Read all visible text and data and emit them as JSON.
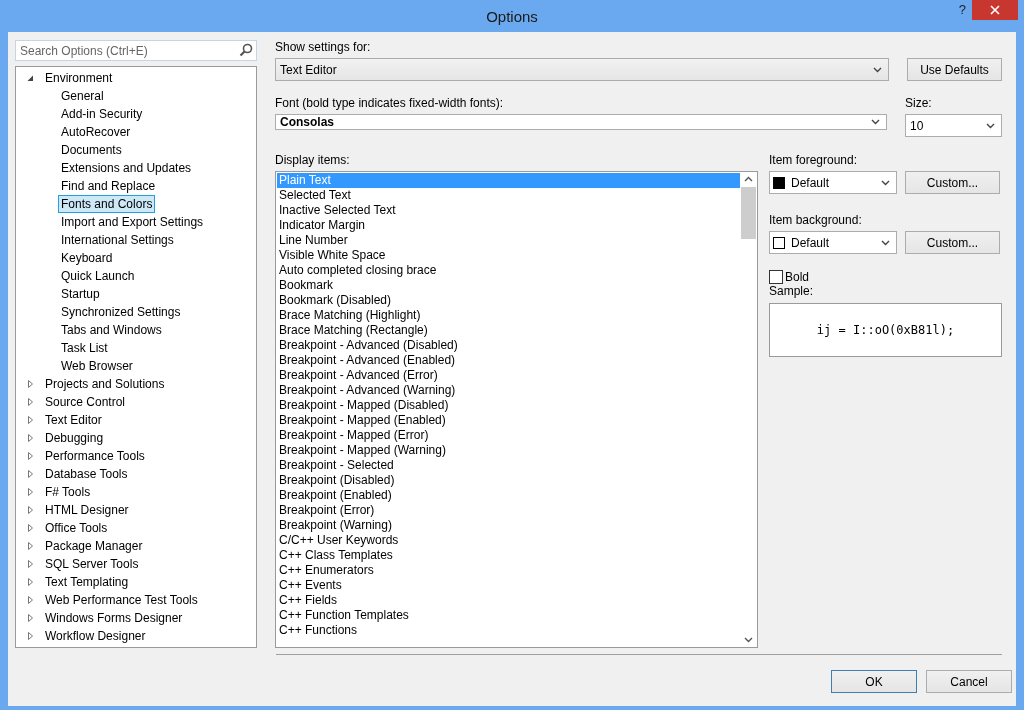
{
  "window": {
    "title": "Options",
    "help": "?"
  },
  "search": {
    "placeholder": "Search Options (Ctrl+E)"
  },
  "tree": [
    {
      "label": "Environment",
      "expanded": true,
      "selected": false,
      "children": [
        {
          "label": "General",
          "selected": false
        },
        {
          "label": "Add-in Security",
          "selected": false
        },
        {
          "label": "AutoRecover",
          "selected": false
        },
        {
          "label": "Documents",
          "selected": false
        },
        {
          "label": "Extensions and Updates",
          "selected": false
        },
        {
          "label": "Find and Replace",
          "selected": false
        },
        {
          "label": "Fonts and Colors",
          "selected": true
        },
        {
          "label": "Import and Export Settings",
          "selected": false
        },
        {
          "label": "International Settings",
          "selected": false
        },
        {
          "label": "Keyboard",
          "selected": false
        },
        {
          "label": "Quick Launch",
          "selected": false
        },
        {
          "label": "Startup",
          "selected": false
        },
        {
          "label": "Synchronized Settings",
          "selected": false
        },
        {
          "label": "Tabs and Windows",
          "selected": false
        },
        {
          "label": "Task List",
          "selected": false
        },
        {
          "label": "Web Browser",
          "selected": false
        }
      ]
    },
    {
      "label": "Projects and Solutions",
      "expanded": false,
      "selected": false
    },
    {
      "label": "Source Control",
      "expanded": false,
      "selected": false
    },
    {
      "label": "Text Editor",
      "expanded": false,
      "selected": false
    },
    {
      "label": "Debugging",
      "expanded": false,
      "selected": false
    },
    {
      "label": "Performance Tools",
      "expanded": false,
      "selected": false
    },
    {
      "label": "Database Tools",
      "expanded": false,
      "selected": false
    },
    {
      "label": "F# Tools",
      "expanded": false,
      "selected": false
    },
    {
      "label": "HTML Designer",
      "expanded": false,
      "selected": false
    },
    {
      "label": "Office Tools",
      "expanded": false,
      "selected": false
    },
    {
      "label": "Package Manager",
      "expanded": false,
      "selected": false
    },
    {
      "label": "SQL Server Tools",
      "expanded": false,
      "selected": false
    },
    {
      "label": "Text Templating",
      "expanded": false,
      "selected": false
    },
    {
      "label": "Web Performance Test Tools",
      "expanded": false,
      "selected": false
    },
    {
      "label": "Windows Forms Designer",
      "expanded": false,
      "selected": false
    },
    {
      "label": "Workflow Designer",
      "expanded": false,
      "selected": false
    }
  ],
  "settings": {
    "show_label": "Show settings for:",
    "show_value": "Text Editor",
    "use_defaults": "Use Defaults",
    "font_label": "Font (bold type indicates fixed-width fonts):",
    "font_value": "Consolas",
    "size_label": "Size:",
    "size_value": "10"
  },
  "display_items": {
    "label": "Display items:",
    "items": [
      {
        "label": "Plain Text",
        "selected": true
      },
      {
        "label": "Selected Text",
        "selected": false
      },
      {
        "label": "Inactive Selected Text",
        "selected": false
      },
      {
        "label": "Indicator Margin",
        "selected": false
      },
      {
        "label": "Line Number",
        "selected": false
      },
      {
        "label": "Visible White Space",
        "selected": false
      },
      {
        "label": "Auto completed closing brace",
        "selected": false
      },
      {
        "label": "Bookmark",
        "selected": false
      },
      {
        "label": "Bookmark (Disabled)",
        "selected": false
      },
      {
        "label": "Brace Matching (Highlight)",
        "selected": false
      },
      {
        "label": "Brace Matching (Rectangle)",
        "selected": false
      },
      {
        "label": "Breakpoint - Advanced (Disabled)",
        "selected": false
      },
      {
        "label": "Breakpoint - Advanced (Enabled)",
        "selected": false
      },
      {
        "label": "Breakpoint - Advanced (Error)",
        "selected": false
      },
      {
        "label": "Breakpoint - Advanced (Warning)",
        "selected": false
      },
      {
        "label": "Breakpoint - Mapped (Disabled)",
        "selected": false
      },
      {
        "label": "Breakpoint - Mapped (Enabled)",
        "selected": false
      },
      {
        "label": "Breakpoint - Mapped (Error)",
        "selected": false
      },
      {
        "label": "Breakpoint - Mapped (Warning)",
        "selected": false
      },
      {
        "label": "Breakpoint - Selected",
        "selected": false
      },
      {
        "label": "Breakpoint (Disabled)",
        "selected": false
      },
      {
        "label": "Breakpoint (Enabled)",
        "selected": false
      },
      {
        "label": "Breakpoint (Error)",
        "selected": false
      },
      {
        "label": "Breakpoint (Warning)",
        "selected": false
      },
      {
        "label": "C/C++ User Keywords",
        "selected": false
      },
      {
        "label": "C++ Class Templates",
        "selected": false
      },
      {
        "label": "C++ Enumerators",
        "selected": false
      },
      {
        "label": "C++ Events",
        "selected": false
      },
      {
        "label": "C++ Fields",
        "selected": false
      },
      {
        "label": "C++ Function Templates",
        "selected": false
      },
      {
        "label": "C++ Functions",
        "selected": false
      }
    ]
  },
  "colors": [
    {
      "label": "Item foreground:",
      "value": "Default",
      "color": "#000000",
      "custom": "Custom..."
    },
    {
      "label": "Item background:",
      "value": "Default",
      "color": "#ffffff",
      "custom": "Custom..."
    }
  ],
  "bold": {
    "label": "Bold",
    "checked": false
  },
  "sample": {
    "label": "Sample:",
    "text": "ij = I::oO(0xB81l);"
  },
  "buttons": [
    {
      "label": "OK",
      "default": true
    },
    {
      "label": "Cancel",
      "default": false
    }
  ]
}
